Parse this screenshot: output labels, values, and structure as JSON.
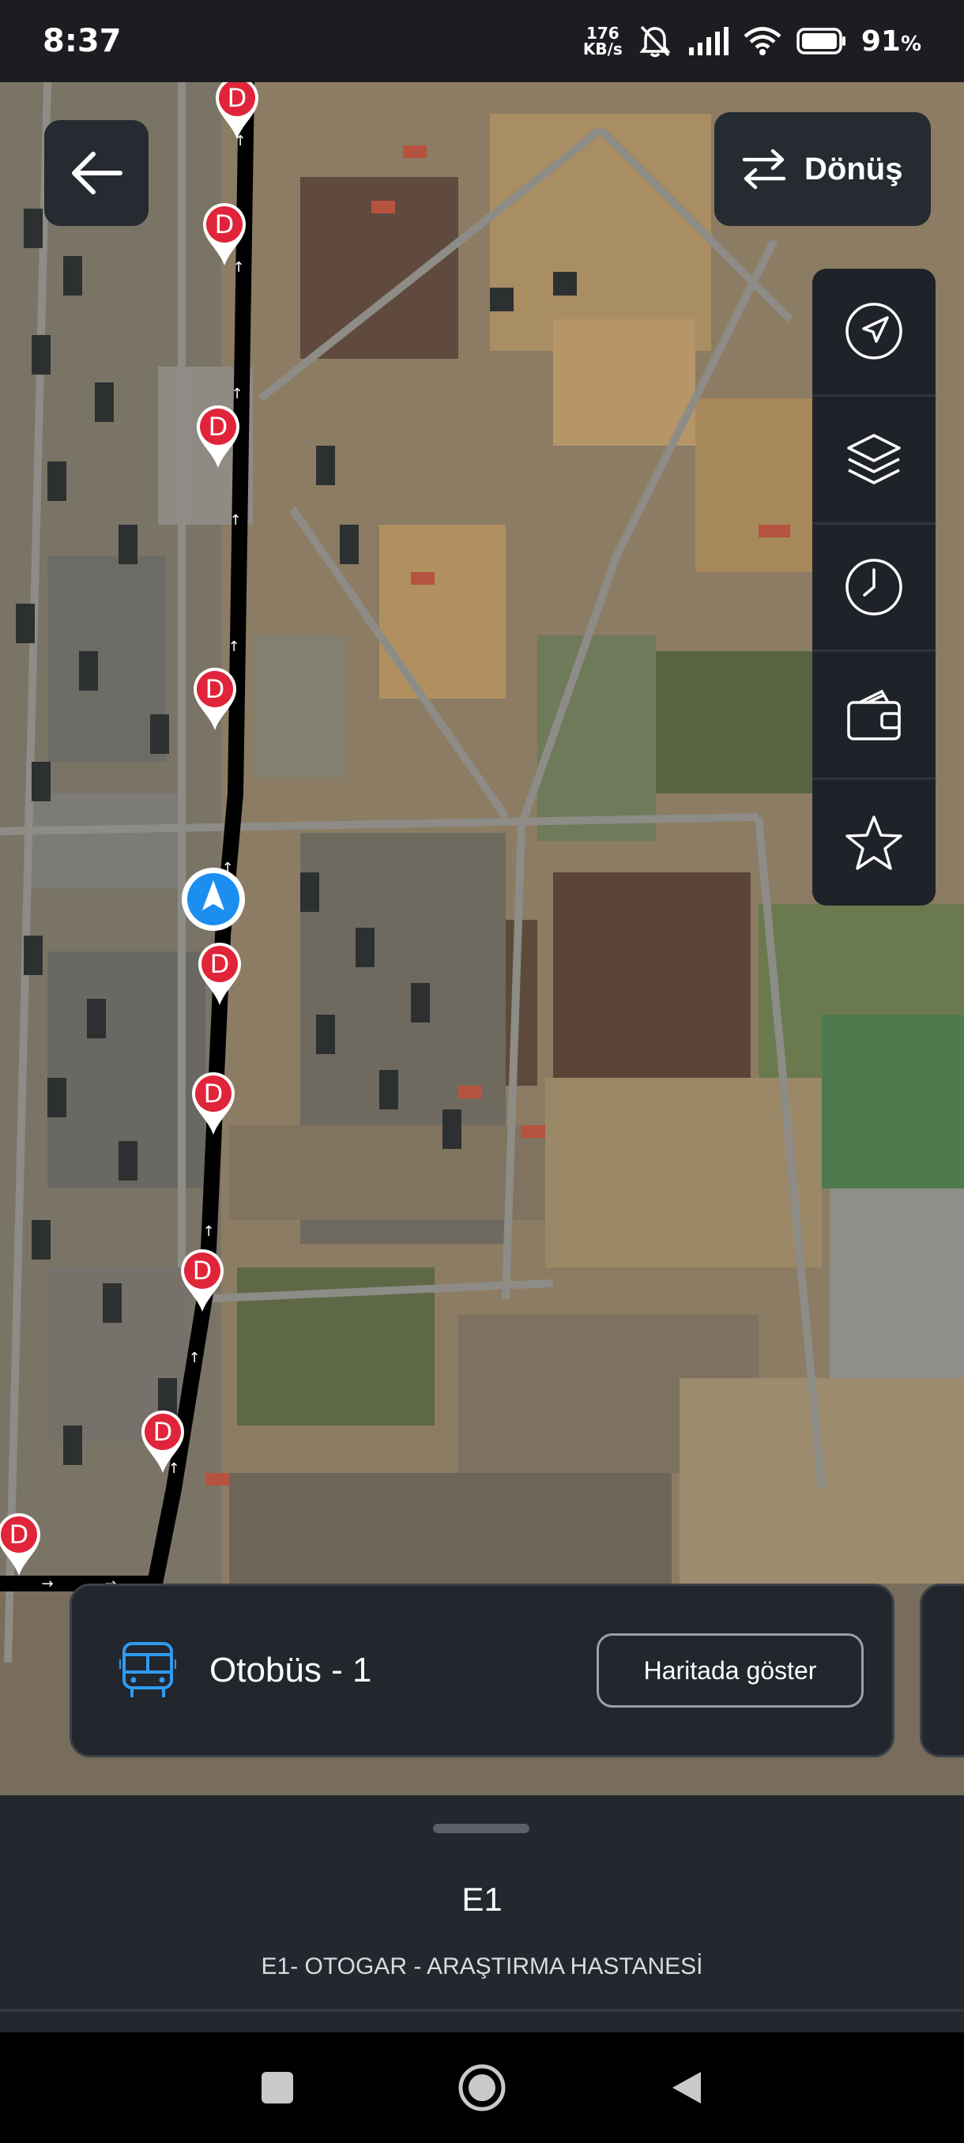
{
  "status_bar": {
    "time": "8:37",
    "net_speed_value": "176",
    "net_speed_unit": "KB/s",
    "battery_value": "91",
    "battery_unit": "%",
    "icons": [
      "mute-icon",
      "signal-icon",
      "wifi-icon",
      "battery-icon"
    ]
  },
  "map": {
    "back_icon": "arrow-left-icon",
    "return_button": {
      "label": "Dönüş",
      "icon": "swap-arrows-icon"
    },
    "tools": [
      {
        "name": "location-icon"
      },
      {
        "name": "layers-icon"
      },
      {
        "name": "clock-icon"
      },
      {
        "name": "wallet-icon"
      },
      {
        "name": "star-icon"
      }
    ],
    "stop_marker_label": "D",
    "route_color": "#000000",
    "marker_color": "#e0243a",
    "user_marker_color": "#1c8ef0"
  },
  "vehicle_card": {
    "icon": "bus-icon",
    "title": "Otobüs - 1",
    "button_label": "Haritada göster"
  },
  "sheet": {
    "route_code": "E1",
    "route_name": "E1- OTOGAR - ARAŞTIRMA HASTANESİ"
  },
  "nav_bar": {
    "icons": [
      "recents-icon",
      "home-icon",
      "back-icon"
    ]
  }
}
